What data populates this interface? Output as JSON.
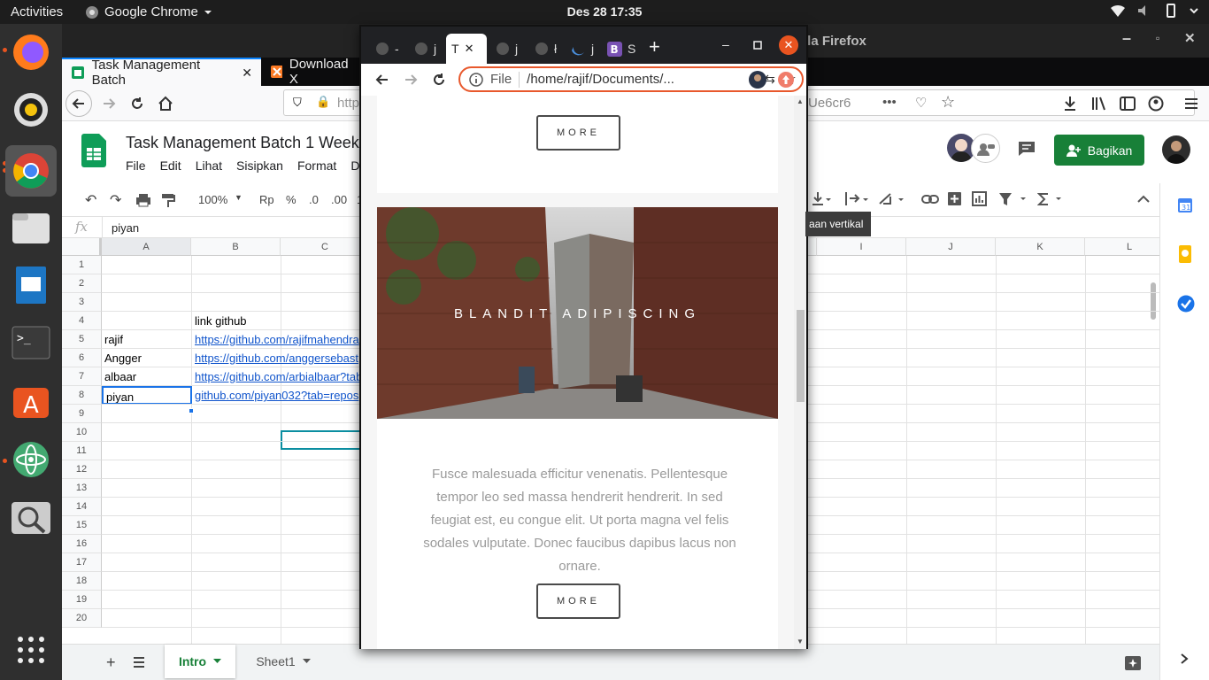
{
  "topbar": {
    "activities": "Activities",
    "app": "Google Chrome",
    "clock": "Des 28  17:35"
  },
  "firefox": {
    "title": "lla Firefox",
    "tabs": [
      {
        "label": "Task Management Batch"
      },
      {
        "label": "Download X"
      }
    ],
    "url": "http",
    "url_tail": "Ue6cr6",
    "url_more": "•••"
  },
  "sheets": {
    "title": "Task Management Batch 1 Weeke",
    "menu": [
      "File",
      "Edit",
      "Lihat",
      "Sisipkan",
      "Format",
      "Da"
    ],
    "share": "Bagikan",
    "tool_zoom": "100%",
    "tool_currency": "Rp",
    "tool_percent": "%",
    "tool_dec1": ".0",
    "tool_dec2": ".00",
    "tool_more": "1",
    "tooltip": "aan vertikal",
    "fx_value": "piyan",
    "cols": [
      "A",
      "B",
      "C",
      "I",
      "J",
      "K",
      "L"
    ],
    "rows": [
      "1",
      "2",
      "3",
      "4",
      "5",
      "6",
      "7",
      "8",
      "9",
      "10",
      "11",
      "12",
      "13",
      "14",
      "15",
      "16",
      "17",
      "18",
      "19",
      "20"
    ],
    "cells": {
      "b3": "link github",
      "a4": "rajif",
      "b4": "https://github.com/rajifmahendra",
      "a5": "Angger",
      "b5": "https://github.com/anggersebast",
      "a6": "albaar",
      "b6": "https://github.com/arbialbaar?tab",
      "a7": "piyan",
      "b7": "github.com/piyan032?tab=repos"
    },
    "sheet_tabs": [
      {
        "label": "Intro"
      },
      {
        "label": "Sheet1"
      }
    ]
  },
  "chrome": {
    "tabs": [
      "-",
      "j",
      "T",
      "j",
      "ł",
      "j",
      "S"
    ],
    "scheme": "File",
    "address": "/home/rajif/Documents/...",
    "more_label": "MORE",
    "hero_title": "BLANDIT ADIPISCING",
    "paragraph": "Fusce malesuada efficitur venenatis. Pellentesque tempor leo sed massa hendrerit hendrerit. In sed feugiat est, eu congue elit. Ut porta magna vel felis sodales vulputate. Donec faucibus dapibus lacus non ornare.",
    "more_label_2": "MORE"
  },
  "colors": {
    "sheets_green": "#188038",
    "omnibox_border": "#e8582c",
    "ubuntu_orange": "#e95420"
  }
}
